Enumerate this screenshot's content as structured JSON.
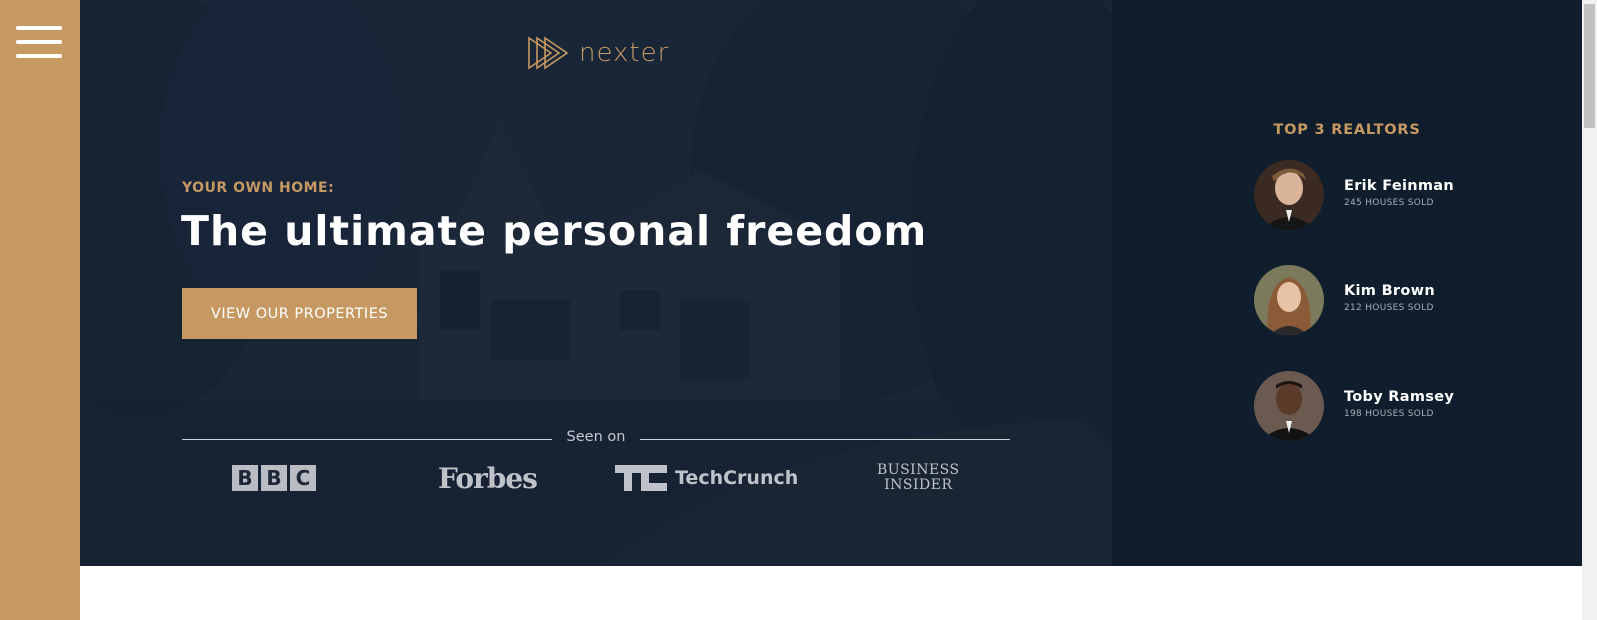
{
  "sidebar": {
    "menu_icon": "hamburger-menu-icon",
    "color": "#c69963"
  },
  "header": {
    "logo_text": "nexter",
    "logo_icon": "play-triangles-icon",
    "subtitle": "YOUR OWN HOME:",
    "title": "The ultimate personal freedom",
    "cta_label": "VIEW OUR PROPERTIES",
    "seen_on": "Seen on",
    "brands": [
      {
        "name": "BBC",
        "letters": [
          "B",
          "B",
          "C"
        ]
      },
      {
        "name": "Forbes"
      },
      {
        "name": "TechCrunch",
        "mark": "TC"
      },
      {
        "name": "Business Insider",
        "line1": "BUSINESS",
        "line2": "INSIDER"
      }
    ]
  },
  "realtors": {
    "heading": "TOP 3 REALTORS",
    "items": [
      {
        "name": "Erik Feinman",
        "sold": "245 HOUSES SOLD"
      },
      {
        "name": "Kim Brown",
        "sold": "212 HOUSES SOLD"
      },
      {
        "name": "Toby Ramsey",
        "sold": "198 HOUSES SOLD"
      }
    ]
  },
  "colors": {
    "primary": "#c69963",
    "dark_navy": "#101d2c",
    "white": "#ffffff"
  }
}
